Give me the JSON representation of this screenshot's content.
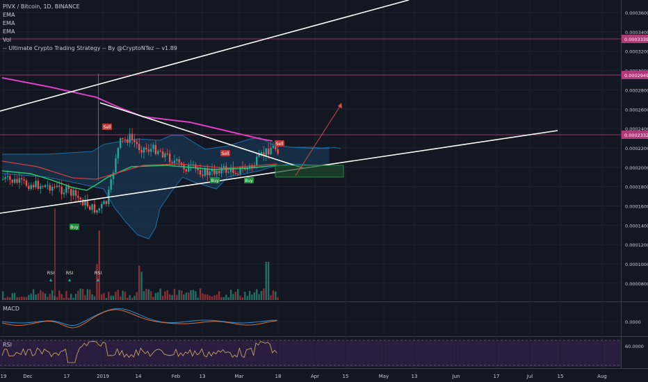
{
  "header": {
    "symbol": "PIVX / Bitcoin, 1D, BINANCE",
    "indicators": [
      "EMA",
      "EMA",
      "EMA",
      "Vol",
      "-- Ultimate Crypto Trading Strategy -- By @CryptoNTez -- v1.89"
    ]
  },
  "price_axis": {
    "ticks": [
      "0.0003600",
      "0.0003400",
      "0.0003200",
      "0.0003000",
      "0.0002800",
      "0.0002600",
      "0.0002400",
      "0.0002200",
      "0.0002000",
      "0.0001800",
      "0.0001600",
      "0.0001400",
      "0.0001200",
      "0.0001000",
      "0.0000800"
    ],
    "badges": [
      {
        "text": "0.0003339",
        "color": "#b03a7a"
      },
      {
        "text": "0.0002949",
        "color": "#b03a7a"
      },
      {
        "text": "0.0002332",
        "color": "#b03a7a"
      }
    ]
  },
  "time_axis": {
    "ticks": [
      "19",
      "Dec",
      "17",
      "2019",
      "14",
      "Feb",
      "13",
      "Mar",
      "18",
      "Apr",
      "15",
      "May",
      "13",
      "Jun",
      "17",
      "Jul",
      "15",
      "Aug"
    ]
  },
  "signals": {
    "sell": [
      "Sell",
      "Sell",
      "Sell"
    ],
    "buy": [
      "Buy",
      "Buy",
      "Buy"
    ],
    "rsi": [
      "RSI",
      "RSI",
      "RSI"
    ]
  },
  "macd": {
    "title": "MACD",
    "axis_label": "0.0000"
  },
  "rsi_pane": {
    "title": "RSI",
    "axis_label": "60.0000"
  },
  "colors": {
    "background": "#131722",
    "up": "#26a69a",
    "down": "#ef5350",
    "magenta": "#e040c8",
    "band": "#1e6fa8",
    "band_fill": "#1a3550",
    "ema_green": "#28c76f",
    "ema_red": "#d04040",
    "rsi_bg": "#2a1d3d"
  }
}
